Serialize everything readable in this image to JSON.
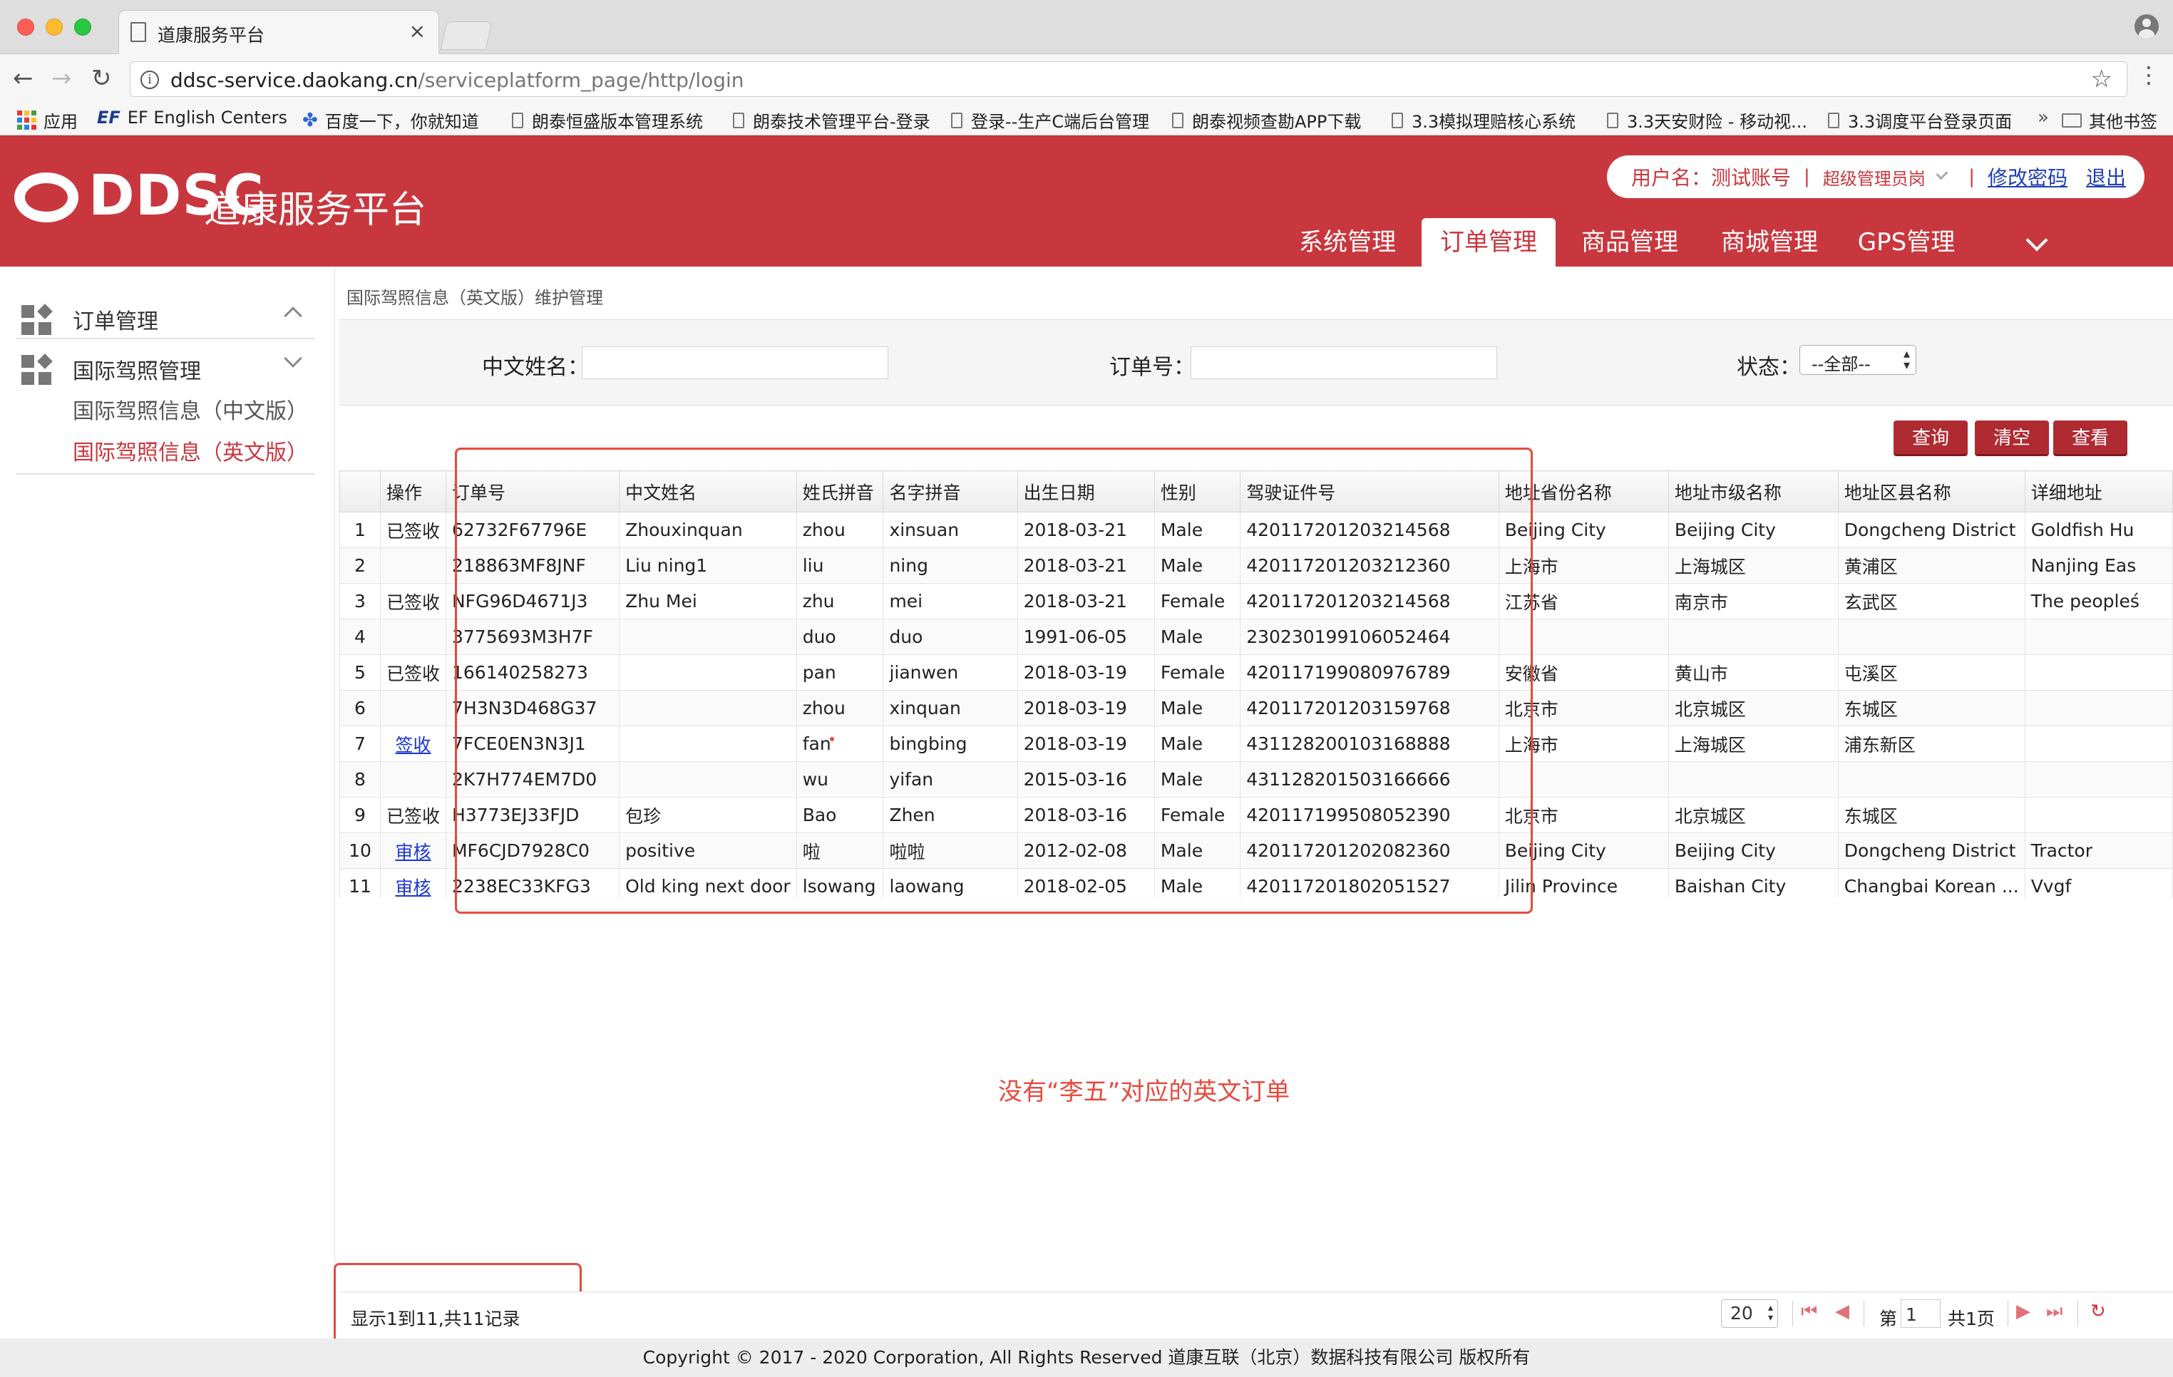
{
  "browser": {
    "tab_title": "道康服务平台",
    "tab_close": "×",
    "url_host": "ddsc-service.daokang.cn",
    "url_path": "/serviceplatform_page/http/login",
    "bookmarks": [
      "应用",
      "EF English Centers",
      "百度一下，你就知道",
      "朗泰恒盛版本管理系统",
      "朗泰技术管理平台-登录",
      "登录--生产C端后台管理",
      "朗泰视频查勘APP下载",
      "3.3模拟理赔核心系统",
      "3.3天安财险 - 移动视...",
      "3.3调度平台登录页面"
    ],
    "bookmarks_more": "»",
    "other_bookmarks": "其他书签",
    "ef_mark": "EF"
  },
  "header": {
    "logo_text": "DDSC",
    "logo_cn": "道康服务平台",
    "user_label": "用户名：测试账号",
    "role": "超级管理员岗",
    "change_password": "修改密码",
    "logout": "退出",
    "sep": "|",
    "nav": [
      "系统管理",
      "订单管理",
      "商品管理",
      "商城管理",
      "GPS管理"
    ],
    "active_nav": "订单管理"
  },
  "sidebar": {
    "section1": "订单管理",
    "section2": "国际驾照管理",
    "items": [
      "国际驾照信息（中文版）",
      "国际驾照信息（英文版）"
    ],
    "active_item": "国际驾照信息（英文版）"
  },
  "main": {
    "breadcrumb": "国际驾照信息（英文版）维护管理",
    "filters": {
      "name_label": "中文姓名：",
      "order_label": "订单号：",
      "status_label": "状态：",
      "status_value": "--全部--"
    },
    "buttons": [
      "查询",
      "清空",
      "查看"
    ],
    "columns": [
      "",
      "操作",
      "订单号",
      "中文姓名",
      "姓氏拼音",
      "名字拼音",
      "出生日期",
      "性别",
      "驾驶证件号",
      "地址省份名称",
      "地址市级名称",
      "地址区县名称",
      "详细地址"
    ],
    "rows": [
      {
        "n": "1",
        "op": "已签收",
        "link": false,
        "order": "62732F67796E",
        "cn": "Zhouxinquan",
        "last": "zhou",
        "first": "xinsuan",
        "dob": "2018-03-21",
        "sex": "Male",
        "lic": "420117201203214568",
        "prov": "Beijing City",
        "city": "Beijing City",
        "dist": "Dongcheng District",
        "addr": "Goldfish Hu"
      },
      {
        "n": "2",
        "op": "",
        "link": false,
        "order": "218863MF8JNF",
        "cn": "Liu ning1",
        "last": "liu",
        "first": "ning",
        "dob": "2018-03-21",
        "sex": "Male",
        "lic": "420117201203212360",
        "prov": "上海市",
        "city": "上海城区",
        "dist": "黄浦区",
        "addr": "Nanjing Eas"
      },
      {
        "n": "3",
        "op": "已签收",
        "link": false,
        "order": "NFG96D4671J3",
        "cn": "Zhu Mei",
        "last": "zhu",
        "first": "mei",
        "dob": "2018-03-21",
        "sex": "Female",
        "lic": "420117201203214568",
        "prov": "江苏省",
        "city": "南京市",
        "dist": "玄武区",
        "addr": "The peopleś"
      },
      {
        "n": "4",
        "op": "",
        "link": false,
        "order": "3775693M3H7F",
        "cn": "",
        "last": "duo",
        "first": "duo",
        "dob": "1991-06-05",
        "sex": "Male",
        "lic": "230230199106052464",
        "prov": "",
        "city": "",
        "dist": "",
        "addr": ""
      },
      {
        "n": "5",
        "op": "已签收",
        "link": false,
        "order": "166140258273",
        "cn": "",
        "last": "pan",
        "first": "jianwen",
        "dob": "2018-03-19",
        "sex": "Female",
        "lic": "420117199080976789",
        "prov": "安徽省",
        "city": "黄山市",
        "dist": "屯溪区",
        "addr": ""
      },
      {
        "n": "6",
        "op": "",
        "link": false,
        "order": "7H3N3D468G37",
        "cn": "",
        "last": "zhou",
        "first": "xinquan",
        "dob": "2018-03-19",
        "sex": "Male",
        "lic": "420117201203159768",
        "prov": "北京市",
        "city": "北京城区",
        "dist": "东城区",
        "addr": ""
      },
      {
        "n": "7",
        "op": "签收",
        "link": true,
        "order": "7FCE0EN3N3J1",
        "cn": "",
        "last": "fan",
        "first": "bingbing",
        "dob": "2018-03-19",
        "sex": "Male",
        "lic": "431128200103168888",
        "prov": "上海市",
        "city": "上海城区",
        "dist": "浦东新区",
        "addr": ""
      },
      {
        "n": "8",
        "op": "",
        "link": false,
        "order": "2K7H774EM7D0",
        "cn": "",
        "last": "wu",
        "first": "yifan",
        "dob": "2015-03-16",
        "sex": "Male",
        "lic": "431128201503166666",
        "prov": "",
        "city": "",
        "dist": "",
        "addr": ""
      },
      {
        "n": "9",
        "op": "已签收",
        "link": false,
        "order": "H3773EJ33FJD",
        "cn": "包珍",
        "last": "Bao",
        "first": "Zhen",
        "dob": "2018-03-16",
        "sex": "Female",
        "lic": "420117199508052390",
        "prov": "北京市",
        "city": "北京城区",
        "dist": "东城区",
        "addr": ""
      },
      {
        "n": "10",
        "op": "审核",
        "link": true,
        "order": "MF6CJD7928C0",
        "cn": "positive",
        "last": "啦",
        "first": "啦啦",
        "dob": "2012-02-08",
        "sex": "Male",
        "lic": "420117201202082360",
        "prov": "Beijing City",
        "city": "Beijing City",
        "dist": "Dongcheng District",
        "addr": "Tractor"
      },
      {
        "n": "11",
        "op": "审核",
        "link": true,
        "order": "2238EC33KFG3",
        "cn": "Old king next door",
        "last": "lsowang",
        "first": "laowang",
        "dob": "2018-02-05",
        "sex": "Male",
        "lic": "420117201802051527",
        "prov": "Jilin Province",
        "city": "Baishan City",
        "dist": "Changbai Korean ...",
        "addr": "Vvgf"
      }
    ],
    "note": "没有“李五”对应的英文订单"
  },
  "pager": {
    "info": "显示1到11,共11记录",
    "page_size": "20",
    "page_prefix": "第",
    "page_num": "1",
    "page_total": "共1页"
  },
  "footer": "Copyright © 2017 - 2020 Corporation, All Rights Reserved 道康互联（北京）数据科技有限公司 版权所有",
  "colors": {
    "brand_red": "#c9373e",
    "annotation_red": "#e74a3c",
    "link_blue": "#1a34d6"
  }
}
